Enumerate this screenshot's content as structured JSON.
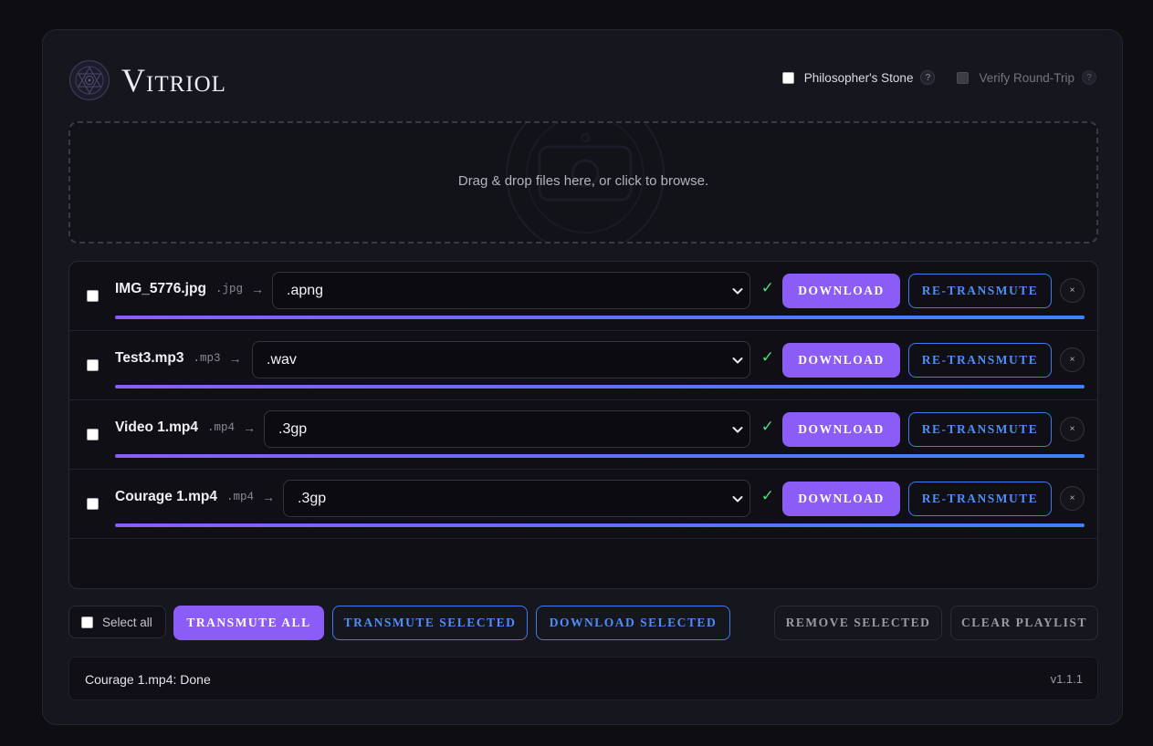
{
  "app": {
    "title": "Vitriol"
  },
  "header": {
    "options": [
      {
        "label": "Philosopher's Stone",
        "help": "?",
        "checked": false,
        "disabled": false
      },
      {
        "label": "Verify Round-Trip",
        "help": "?",
        "checked": false,
        "disabled": true
      }
    ]
  },
  "dropzone": {
    "text": "Drag & drop files here, or click to browse."
  },
  "files": [
    {
      "name": "IMG_5776.jpg",
      "ext": ".jpg",
      "arrow": "→",
      "target": ".apng",
      "done": "✓",
      "download": "Download",
      "retransmute": "Re-Transmute",
      "remove": "×",
      "progress": 100
    },
    {
      "name": "Test3.mp3",
      "ext": ".mp3",
      "arrow": "→",
      "target": ".wav",
      "done": "✓",
      "download": "Download",
      "retransmute": "Re-Transmute",
      "remove": "×",
      "progress": 100
    },
    {
      "name": "Video 1.mp4",
      "ext": ".mp4",
      "arrow": "→",
      "target": ".3gp",
      "done": "✓",
      "download": "Download",
      "retransmute": "Re-Transmute",
      "remove": "×",
      "progress": 100
    },
    {
      "name": "Courage 1.mp4",
      "ext": ".mp4",
      "arrow": "→",
      "target": ".3gp",
      "done": "✓",
      "download": "Download",
      "retransmute": "Re-Transmute",
      "remove": "×",
      "progress": 100
    }
  ],
  "footer": {
    "select_all": "Select all",
    "transmute_all": "Transmute All",
    "transmute_selected": "Transmute Selected",
    "download_selected": "Download Selected",
    "remove_selected": "Remove Selected",
    "clear_playlist": "Clear Playlist"
  },
  "status": {
    "text": "Courage 1.mp4: Done",
    "version": "v1.1.1"
  },
  "colors": {
    "accent": "#8b5cf6",
    "outline": "#3f7bea",
    "success": "#4ade80"
  }
}
